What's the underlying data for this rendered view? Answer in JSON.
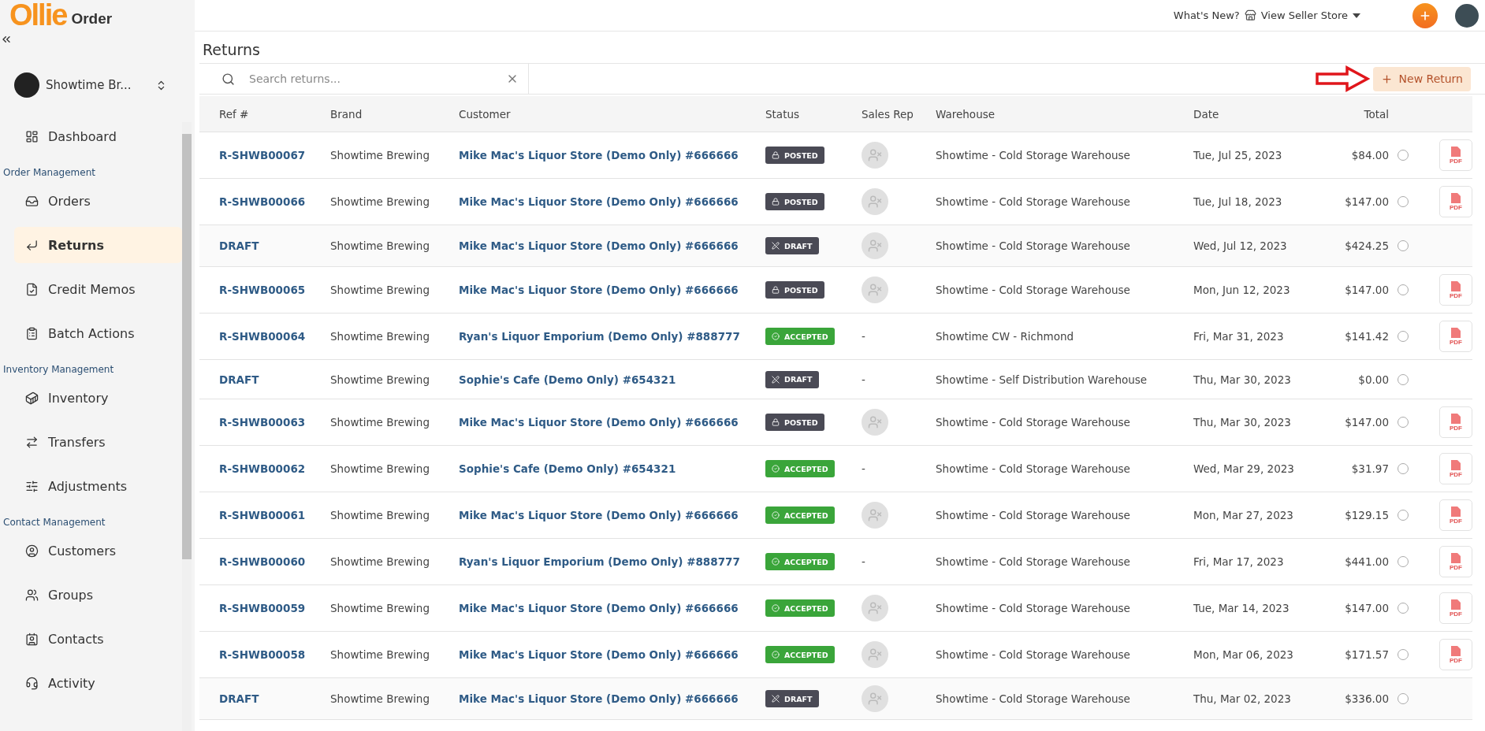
{
  "logo": {
    "brand": "Ollie",
    "product": "Order"
  },
  "brand_selector": {
    "name": "Showtime Br..."
  },
  "nav": [
    {
      "items": [
        {
          "label": "Dashboard",
          "selected": false
        }
      ]
    },
    {
      "title": "Order Management",
      "items": [
        {
          "label": "Orders",
          "selected": false
        },
        {
          "label": "Returns",
          "selected": true
        },
        {
          "label": "Credit Memos",
          "selected": false
        },
        {
          "label": "Batch Actions",
          "selected": false
        }
      ]
    },
    {
      "title": "Inventory Management",
      "items": [
        {
          "label": "Inventory",
          "selected": false
        },
        {
          "label": "Transfers",
          "selected": false
        },
        {
          "label": "Adjustments",
          "selected": false
        }
      ]
    },
    {
      "title": "Contact Management",
      "items": [
        {
          "label": "Customers",
          "selected": false
        },
        {
          "label": "Groups",
          "selected": false
        },
        {
          "label": "Contacts",
          "selected": false
        },
        {
          "label": "Activity",
          "selected": false
        }
      ]
    }
  ],
  "header": {
    "whats_new": "What's New?",
    "store_link": "View Seller Store"
  },
  "page_title": "Returns",
  "search": {
    "placeholder": "Search returns..."
  },
  "new_button": "New Return",
  "table": {
    "columns": [
      "Ref #",
      "Brand",
      "Customer",
      "Status",
      "Sales Rep",
      "Warehouse",
      "Date",
      "Total"
    ],
    "rows": [
      {
        "ref": "R-SHWB00067",
        "brand": "Showtime Brewing",
        "customer": "Mike Mac's Liquor Store (Demo Only) #666666",
        "status": {
          "kind": "posted",
          "label": "POSTED"
        },
        "sales_rep": {
          "kind": "avatar"
        },
        "warehouse": "Showtime - Cold Storage Warehouse",
        "date": "Tue, Jul 25, 2023",
        "total": "$84.00",
        "selected": false,
        "pdf": "PDF"
      },
      {
        "ref": "R-SHWB00066",
        "brand": "Showtime Brewing",
        "customer": "Mike Mac's Liquor Store (Demo Only) #666666",
        "status": {
          "kind": "posted",
          "label": "POSTED"
        },
        "sales_rep": {
          "kind": "avatar"
        },
        "warehouse": "Showtime - Cold Storage Warehouse",
        "date": "Tue, Jul 18, 2023",
        "total": "$147.00",
        "selected": false,
        "pdf": "PDF"
      },
      {
        "ref": "DRAFT",
        "brand": "Showtime Brewing",
        "customer": "Mike Mac's Liquor Store (Demo Only) #666666",
        "status": {
          "kind": "draft",
          "label": "DRAFT"
        },
        "sales_rep": {
          "kind": "avatar"
        },
        "warehouse": "Showtime - Cold Storage Warehouse",
        "date": "Wed, Jul 12, 2023",
        "total": "$424.25",
        "selected": false
      },
      {
        "ref": "R-SHWB00065",
        "brand": "Showtime Brewing",
        "customer": "Mike Mac's Liquor Store (Demo Only) #666666",
        "status": {
          "kind": "posted",
          "label": "POSTED"
        },
        "sales_rep": {
          "kind": "avatar"
        },
        "warehouse": "Showtime - Cold Storage Warehouse",
        "date": "Mon, Jun 12, 2023",
        "total": "$147.00",
        "selected": false,
        "pdf": "PDF"
      },
      {
        "ref": "R-SHWB00064",
        "brand": "Showtime Brewing",
        "customer": "Ryan's Liquor Emporium (Demo Only) #888777",
        "status": {
          "kind": "accepted",
          "label": "ACCEPTED"
        },
        "sales_rep": {
          "kind": "text",
          "text": "-"
        },
        "warehouse": "Showtime CW - Richmond",
        "date": "Fri, Mar 31, 2023",
        "total": "$141.42",
        "selected": false,
        "pdf": "PDF"
      },
      {
        "ref": "DRAFT",
        "brand": "Showtime Brewing",
        "customer": "Sophie's Cafe (Demo Only) #654321",
        "status": {
          "kind": "draft",
          "label": "DRAFT"
        },
        "sales_rep": {
          "kind": "text",
          "text": "-"
        },
        "warehouse": "Showtime - Self Distribution Warehouse",
        "date": "Thu, Mar 30, 2023",
        "total": "$0.00",
        "selected": false
      },
      {
        "ref": "R-SHWB00063",
        "brand": "Showtime Brewing",
        "customer": "Mike Mac's Liquor Store (Demo Only) #666666",
        "status": {
          "kind": "posted",
          "label": "POSTED"
        },
        "sales_rep": {
          "kind": "avatar"
        },
        "warehouse": "Showtime - Cold Storage Warehouse",
        "date": "Thu, Mar 30, 2023",
        "total": "$147.00",
        "selected": false,
        "pdf": "PDF"
      },
      {
        "ref": "R-SHWB00062",
        "brand": "Showtime Brewing",
        "customer": "Sophie's Cafe (Demo Only) #654321",
        "status": {
          "kind": "accepted",
          "label": "ACCEPTED"
        },
        "sales_rep": {
          "kind": "text",
          "text": "-"
        },
        "warehouse": "Showtime - Cold Storage Warehouse",
        "date": "Wed, Mar 29, 2023",
        "total": "$31.97",
        "selected": false,
        "pdf": "PDF"
      },
      {
        "ref": "R-SHWB00061",
        "brand": "Showtime Brewing",
        "customer": "Mike Mac's Liquor Store (Demo Only) #666666",
        "status": {
          "kind": "accepted",
          "label": "ACCEPTED"
        },
        "sales_rep": {
          "kind": "avatar"
        },
        "warehouse": "Showtime - Cold Storage Warehouse",
        "date": "Mon, Mar 27, 2023",
        "total": "$129.15",
        "selected": false,
        "pdf": "PDF"
      },
      {
        "ref": "R-SHWB00060",
        "brand": "Showtime Brewing",
        "customer": "Ryan's Liquor Emporium (Demo Only) #888777",
        "status": {
          "kind": "accepted",
          "label": "ACCEPTED"
        },
        "sales_rep": {
          "kind": "text",
          "text": "-"
        },
        "warehouse": "Showtime - Cold Storage Warehouse",
        "date": "Fri, Mar 17, 2023",
        "total": "$441.00",
        "selected": false,
        "pdf": "PDF"
      },
      {
        "ref": "R-SHWB00059",
        "brand": "Showtime Brewing",
        "customer": "Mike Mac's Liquor Store (Demo Only) #666666",
        "status": {
          "kind": "accepted",
          "label": "ACCEPTED"
        },
        "sales_rep": {
          "kind": "avatar"
        },
        "warehouse": "Showtime - Cold Storage Warehouse",
        "date": "Tue, Mar 14, 2023",
        "total": "$147.00",
        "selected": false,
        "pdf": "PDF"
      },
      {
        "ref": "R-SHWB00058",
        "brand": "Showtime Brewing",
        "customer": "Mike Mac's Liquor Store (Demo Only) #666666",
        "status": {
          "kind": "accepted",
          "label": "ACCEPTED"
        },
        "sales_rep": {
          "kind": "avatar"
        },
        "warehouse": "Showtime - Cold Storage Warehouse",
        "date": "Mon, Mar 06, 2023",
        "total": "$171.57",
        "selected": false,
        "pdf": "PDF"
      },
      {
        "ref": "DRAFT",
        "brand": "Showtime Brewing",
        "customer": "Mike Mac's Liquor Store (Demo Only) #666666",
        "status": {
          "kind": "draft",
          "label": "DRAFT"
        },
        "sales_rep": {
          "kind": "avatar"
        },
        "warehouse": "Showtime - Cold Storage Warehouse",
        "date": "Thu, Mar 02, 2023",
        "total": "$336.00",
        "selected": false
      }
    ]
  }
}
